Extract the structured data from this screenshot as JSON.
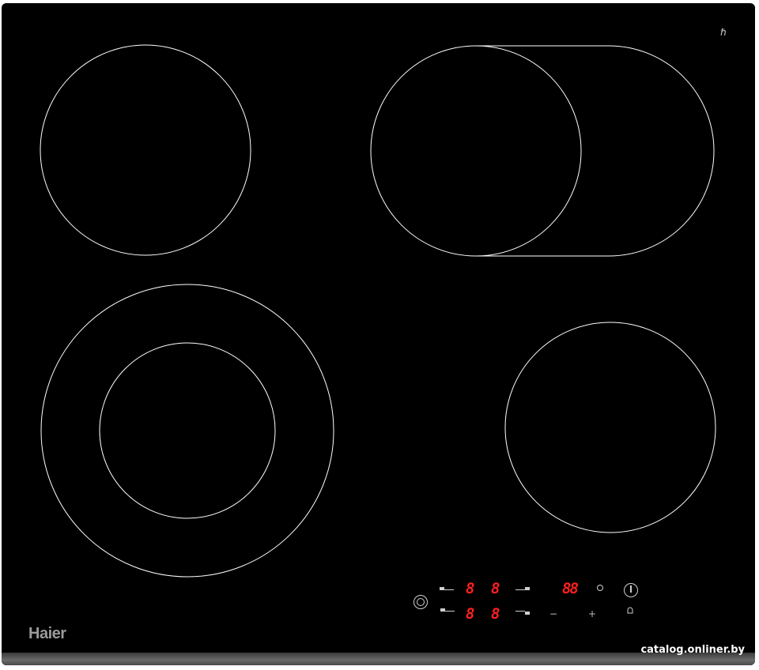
{
  "product": {
    "brand": "Haier",
    "watermark": "catalog.onliner.by"
  },
  "colors": {
    "glass": "#000000",
    "zone_outline": "#ffffff",
    "display_red": "#ff2020",
    "controls": "#bdbdbd"
  },
  "cooking_zones": [
    {
      "name": "rear-left-zone",
      "shape": "single-circle"
    },
    {
      "name": "rear-right-zone",
      "shape": "oval-extended"
    },
    {
      "name": "front-left-zone",
      "shape": "dual-ring"
    },
    {
      "name": "front-right-zone",
      "shape": "single-circle"
    }
  ],
  "control_panel": {
    "zone_displays": [
      "8",
      "8",
      "8",
      "8"
    ],
    "timer_display": "88",
    "minus_label": "−",
    "plus_label": "+",
    "icons": [
      "lock-icon",
      "timer-icon",
      "power-icon",
      "key-lock-icon",
      "hot-surface-icon"
    ]
  }
}
